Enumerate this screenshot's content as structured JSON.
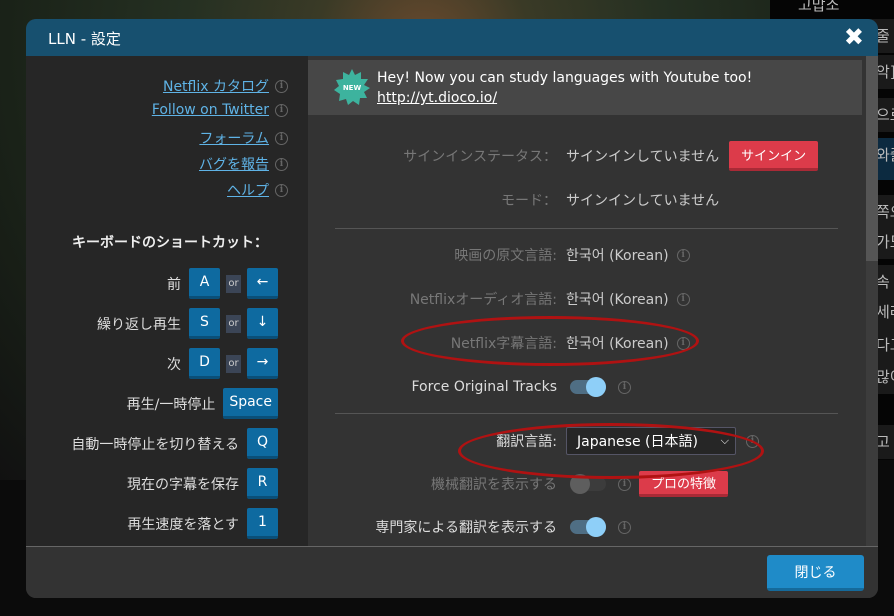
{
  "background": {
    "side_subtitles": [
      "고맙소",
      "줄",
      "악]",
      "으로",
      "와줄",
      "쪽으",
      "가도",
      "속 그",
      "세라",
      "다고",
      "많이",
      "고 고"
    ]
  },
  "modal": {
    "title": "LLN - 設定",
    "close_icon": "close-x-icon",
    "links": [
      "Netflix カタログ",
      "Follow on Twitter",
      "フォーラム",
      "バグを報告",
      "ヘルプ"
    ],
    "shortcuts_title": "キーボードのショートカット：",
    "or_label": "or",
    "shortcuts": [
      {
        "label": "前",
        "keys": [
          "A",
          "←"
        ]
      },
      {
        "label": "繰り返し再生",
        "keys": [
          "S",
          "↓"
        ]
      },
      {
        "label": "次",
        "keys": [
          "D",
          "→"
        ]
      },
      {
        "label": "再生/一時停止",
        "keys": [
          "Space"
        ]
      },
      {
        "label": "自動一時停止を切り替える",
        "keys": [
          "Q"
        ]
      },
      {
        "label": "現在の字幕を保存",
        "keys": [
          "R"
        ]
      },
      {
        "label": "再生速度を落とす",
        "keys": [
          "1"
        ]
      }
    ],
    "banner": {
      "badge": "NEW",
      "text": "Hey! Now you can study languages with Youtube too!",
      "link": "http://yt.dioco.io/"
    },
    "settings": {
      "signin_status_label": "サインインステータス：",
      "signin_status_value": "サインインしていません",
      "signin_button": "サインイン",
      "mode_label": "モード：",
      "mode_value": "サインインしていません",
      "original_lang_label": "映画の原文言語:",
      "original_lang_value": "한국어 (Korean)",
      "audio_lang_label": "Netflixオーディオ言語:",
      "audio_lang_value": "한국어 (Korean)",
      "subtitle_lang_label": "Netflix字幕言語:",
      "subtitle_lang_value": "한국어 (Korean)",
      "force_tracks_label": "Force Original Tracks",
      "force_tracks_on": true,
      "translation_lang_label": "翻訳言語:",
      "translation_lang_value": "Japanese (日本語)",
      "machine_translation_label": "機械翻訳を表示する",
      "machine_translation_on": false,
      "pro_badge": "プロの特徴",
      "expert_translation_label": "専門家による翻訳を表示する",
      "expert_translation_on": true
    },
    "close_button": "閉じる"
  },
  "colors": {
    "header": "#17506f",
    "accent": "#1f8bc8",
    "danger": "#dc3b4a",
    "link": "#5fb3e6",
    "annotation": "#b01212"
  }
}
